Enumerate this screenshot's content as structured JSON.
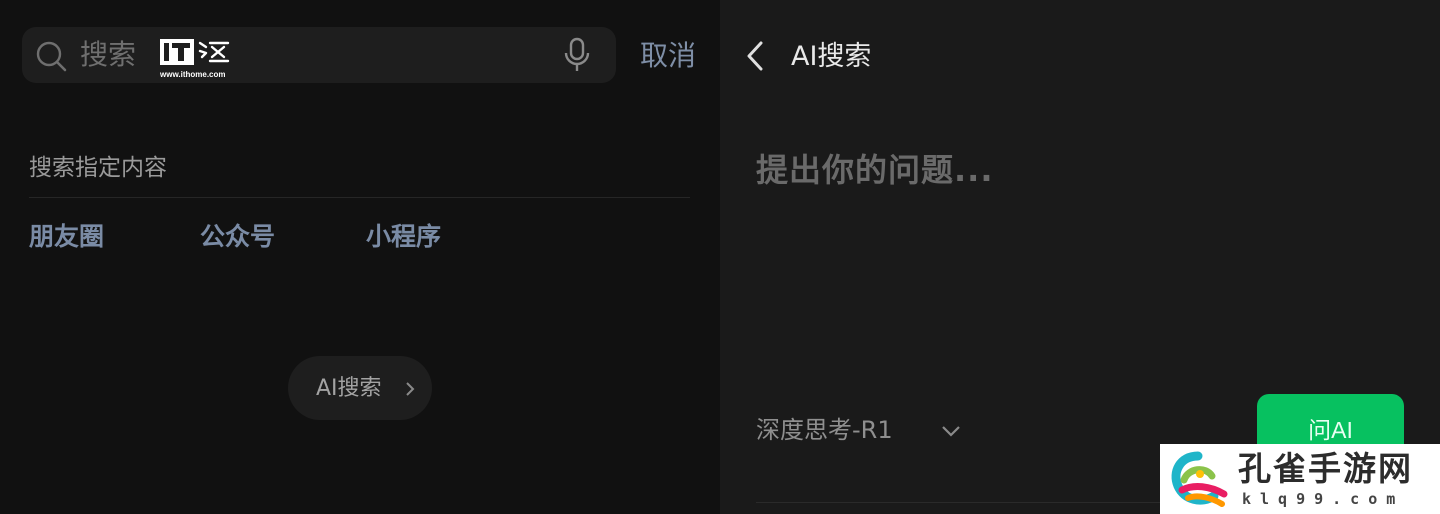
{
  "left": {
    "search": {
      "placeholder": "搜索",
      "watermark_url": "www.ithome.com"
    },
    "cancel_label": "取消",
    "section_title": "搜索指定内容",
    "categories": [
      {
        "label": "朋友圈",
        "icon": "none"
      },
      {
        "label": "公众号",
        "icon": "none"
      },
      {
        "label": "小程序",
        "icon": "none"
      }
    ],
    "ai_chip_label": "AI搜索"
  },
  "right": {
    "title": "AI搜索",
    "question_placeholder": "提出你的问题...",
    "model_label": "深度思考-R1",
    "ask_button_label": "问AI"
  },
  "watermark": {
    "brand_name": "孔雀手游网",
    "brand_url": "klq99.com"
  },
  "colors": {
    "accent_link": "#7e8ea6",
    "button_green": "#07c160",
    "background_dark": "#111111",
    "background_panel": "#1a1a1a"
  },
  "icons": [
    "search-icon",
    "mic-icon",
    "chevron-right-icon",
    "back-arrow-icon",
    "chevron-down-icon"
  ]
}
